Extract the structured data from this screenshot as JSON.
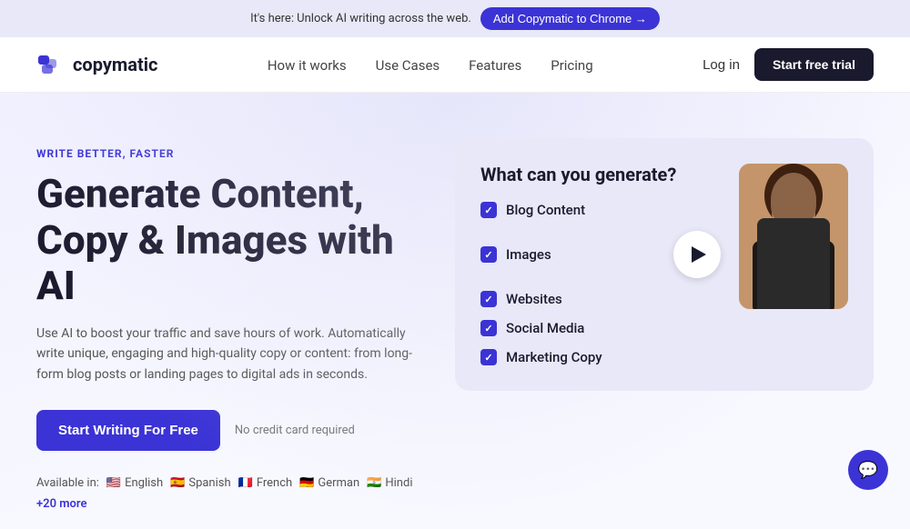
{
  "banner": {
    "text": "It's here: Unlock AI writing across the web.",
    "cta_label": "Add Copymatic to Chrome →"
  },
  "navbar": {
    "logo_text": "copymatic",
    "links": [
      {
        "label": "How it works",
        "id": "how-it-works"
      },
      {
        "label": "Use Cases",
        "id": "use-cases"
      },
      {
        "label": "Features",
        "id": "features"
      },
      {
        "label": "Pricing",
        "id": "pricing"
      }
    ],
    "login_label": "Log in",
    "trial_label": "Start free trial"
  },
  "hero": {
    "tagline": "WRITE BETTER, FASTER",
    "title_line1": "Generate Content,",
    "title_line2": "Copy & Images with AI",
    "description": "Use AI to boost your traffic and save hours of work. Automatically write unique, engaging and high-quality copy or content: from long-form blog posts or landing pages to digital ads in seconds.",
    "cta_label": "Start Writing For Free",
    "no_cc_text": "No credit card required",
    "available_label": "Available in:",
    "languages": [
      {
        "flag": "🇺🇸",
        "name": "English"
      },
      {
        "flag": "🇪🇸",
        "name": "Spanish"
      },
      {
        "flag": "🇫🇷",
        "name": "French"
      },
      {
        "flag": "🇩🇪",
        "name": "German"
      },
      {
        "flag": "🇮🇳",
        "name": "Hindi"
      },
      {
        "more": "+20 more"
      }
    ]
  },
  "generate_card": {
    "title": "What can you generate?",
    "items": [
      "Blog Content",
      "Images",
      "Websites",
      "Social Media",
      "Marketing Copy"
    ]
  },
  "chat_icon": "💬",
  "colors": {
    "brand_purple": "#3b33d5",
    "dark": "#1a1a2e",
    "banner_bg": "#e8e8f8"
  }
}
